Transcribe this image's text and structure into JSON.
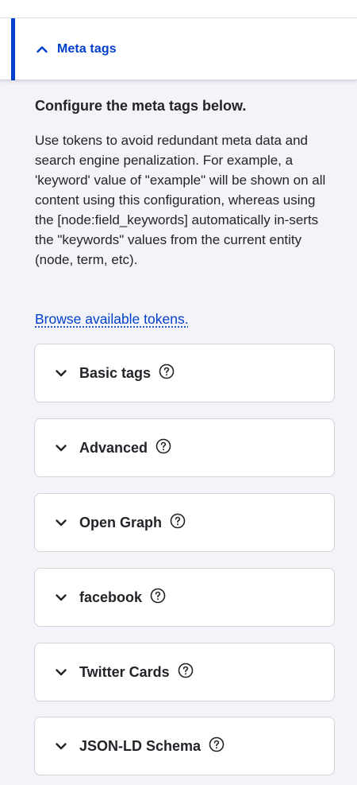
{
  "section": {
    "title": "Meta tags",
    "expanded": true,
    "accent_color": "#003ecc"
  },
  "content": {
    "heading": "Configure the meta tags below.",
    "description": "Use tokens to avoid redundant meta data and search engine penalization. For example, a 'keyword' value of \"example\" will be shown on all content using this configuration, whereas using the [node:field_keywords] automatically in-serts the \"keywords\" values from the current entity (node, term, etc).",
    "browse_link": "Browse available tokens."
  },
  "groups": [
    {
      "label": "Basic tags",
      "icon": "chevron-down-icon",
      "help_icon": "help-icon"
    },
    {
      "label": "Advanced",
      "icon": "chevron-down-icon",
      "help_icon": "help-icon"
    },
    {
      "label": "Open Graph",
      "icon": "chevron-down-icon",
      "help_icon": "help-icon"
    },
    {
      "label": "facebook",
      "icon": "chevron-down-icon",
      "help_icon": "help-icon"
    },
    {
      "label": "Twitter Cards",
      "icon": "chevron-down-icon",
      "help_icon": "help-icon"
    },
    {
      "label": "JSON-LD Schema",
      "icon": "chevron-down-icon",
      "help_icon": "help-icon"
    }
  ]
}
